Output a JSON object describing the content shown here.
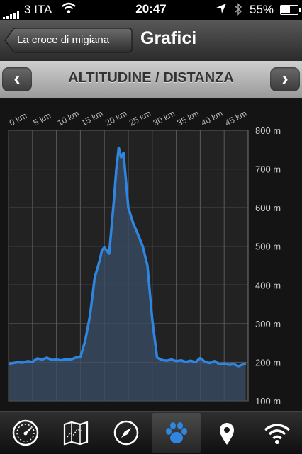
{
  "status_bar": {
    "carrier": "3 ITA",
    "time": "20:47",
    "battery": "55%"
  },
  "nav": {
    "back_label": "La  croce di migiana",
    "title": "Grafici"
  },
  "pager": {
    "title": "ALTITUDINE / DISTANZA",
    "prev_icon": "chevron-left-icon",
    "next_icon": "chevron-right-icon"
  },
  "chart_data": {
    "type": "area",
    "title": "",
    "xlabel": "",
    "ylabel": "",
    "x_ticks": [
      "0 km",
      "5 km",
      "10 km",
      "15 km",
      "20 km",
      "25 km",
      "30 km",
      "35 km",
      "40 km",
      "45 km"
    ],
    "y_ticks": [
      "800 m",
      "700 m",
      "600 m",
      "500 m",
      "400 m",
      "300 m",
      "200 m",
      "100 m"
    ],
    "xlim": [
      0,
      50
    ],
    "ylim": [
      100,
      800
    ],
    "grid": true,
    "line_color": "#2f86e0",
    "x": [
      0,
      1,
      2,
      3,
      4,
      5,
      6,
      7,
      8,
      9,
      10,
      11,
      12,
      13,
      14,
      15,
      16,
      17,
      18,
      19,
      19.5,
      20,
      21,
      22,
      22.5,
      23,
      23.5,
      24,
      25,
      26,
      27,
      28,
      29,
      30,
      31,
      32,
      33,
      34,
      35,
      36,
      37,
      38,
      39,
      40,
      41,
      42,
      43,
      44,
      45,
      46,
      47,
      48,
      49.5
    ],
    "y": [
      196,
      198,
      200,
      199,
      203,
      201,
      210,
      207,
      212,
      206,
      207,
      205,
      208,
      207,
      212,
      213,
      256,
      320,
      420,
      462,
      490,
      497,
      481,
      619,
      700,
      755,
      730,
      742,
      600,
      560,
      531,
      500,
      450,
      310,
      212,
      206,
      204,
      207,
      203,
      205,
      201,
      204,
      200,
      211,
      201,
      198,
      203,
      195,
      197,
      193,
      195,
      190,
      197
    ]
  },
  "tabbar": {
    "tabs": [
      {
        "name": "speedometer-icon",
        "selected": false
      },
      {
        "name": "map-icon",
        "selected": false
      },
      {
        "name": "compass-icon",
        "selected": false
      },
      {
        "name": "paw-icon",
        "selected": true
      },
      {
        "name": "location-pin-icon",
        "selected": false
      },
      {
        "name": "wifi-icon",
        "selected": false
      }
    ]
  }
}
